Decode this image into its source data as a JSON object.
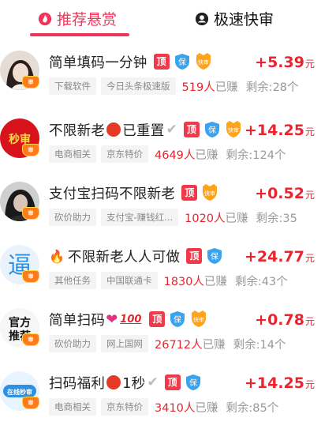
{
  "tabs": [
    {
      "label": "推荐悬赏",
      "active": true,
      "icon": "fire-drop-icon"
    },
    {
      "label": "极速快审",
      "active": false,
      "icon": "user-circle-icon"
    }
  ],
  "colors": {
    "accent": "#f0345a",
    "reward": "#e8242f",
    "tag_bg": "#f4f4f4"
  },
  "tasks": [
    {
      "title": "简单填码一分钟",
      "badge_ding": "顶",
      "badge_bao": "保",
      "badge_kuai": "快审",
      "reward_amount": "+5.39",
      "reward_unit": "元",
      "tags": [
        "下载软件",
        "今日头条极速版"
      ],
      "earned_count": "519人",
      "earned_suffix": "已赚",
      "remaining": "剩余:28个",
      "avatar_badge": "审",
      "avatar_label": ""
    },
    {
      "title_prefix": "不限新老",
      "title_suffix": "已重置",
      "badge_ding": "顶",
      "badge_bao": "保",
      "badge_kuai": "快审",
      "reward_amount": "+14.25",
      "reward_unit": "元",
      "tags": [
        "电商相关",
        "京东特价"
      ],
      "earned_count": "4649人",
      "earned_suffix": "已赚",
      "remaining": "剩余:124个",
      "avatar_label": "秒审",
      "avatar_badge": "审"
    },
    {
      "title": "支付宝扫码不限新老",
      "badge_ding": "顶",
      "badge_kuai": "快审",
      "reward_amount": "+0.52",
      "reward_unit": "元",
      "tags": [
        "砍价助力",
        "支付宝-赚钱红..."
      ],
      "earned_count": "1020人",
      "earned_suffix": "已赚",
      "remaining": "剩余:35",
      "avatar_badge": "审"
    },
    {
      "title": "不限新老人人可做",
      "badge_ding": "顶",
      "badge_bao": "保",
      "reward_amount": "+24.77",
      "reward_unit": "元",
      "tags": [
        "其他任务",
        "中国联通卡"
      ],
      "earned_count": "1830人",
      "earned_suffix": "已赚",
      "remaining": "剩余:43个",
      "avatar_label": "逼",
      "avatar_badge": "审"
    },
    {
      "title": "简单扫码",
      "badge_ding": "顶",
      "badge_bao": "保",
      "badge_kuai": "快审",
      "reward_amount": "+0.78",
      "reward_unit": "元",
      "tags": [
        "砍价助力",
        "网上国网"
      ],
      "earned_count": "26712人",
      "earned_suffix": "已赚",
      "remaining": "剩余:14个",
      "avatar_label_top": "官方",
      "avatar_label_bottom": "推荐",
      "avatar_badge": "审"
    },
    {
      "title_prefix": "扫码福利",
      "title_suffix": "1秒",
      "badge_ding": "顶",
      "badge_bao": "保",
      "reward_amount": "+14.25",
      "reward_unit": "元",
      "tags": [
        "电商相关",
        "京东特价"
      ],
      "earned_count": "3410人",
      "earned_suffix": "已赚",
      "remaining": "剩余:85个",
      "avatar_label": "在线秒审",
      "avatar_badge": "审"
    }
  ]
}
